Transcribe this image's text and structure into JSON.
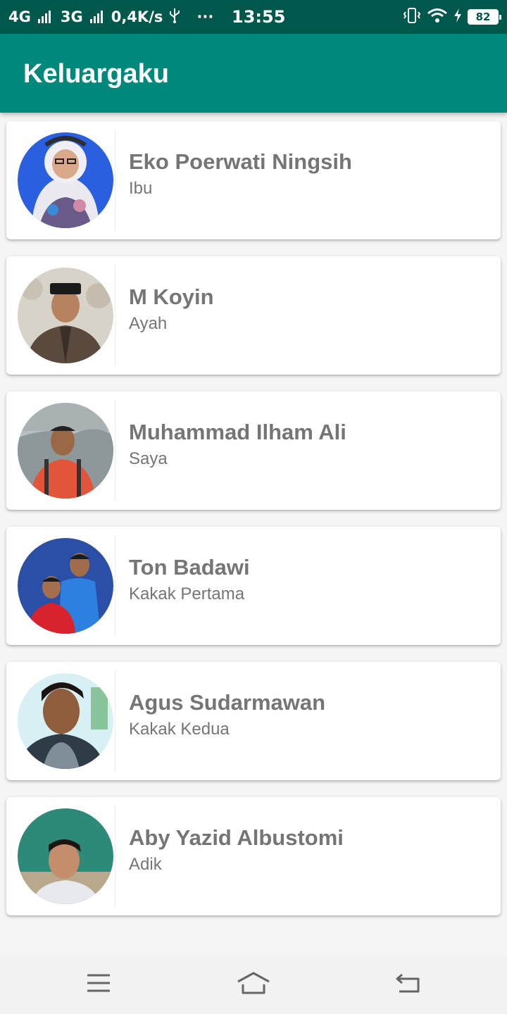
{
  "status_bar": {
    "network_1": "4G",
    "network_2": "3G",
    "speed": "0,4K/s",
    "dots": "···",
    "time": "13:55",
    "battery": "82",
    "icons": [
      "usb-icon",
      "vibrate-icon",
      "wifi-icon",
      "charging-icon",
      "battery-icon"
    ]
  },
  "app_bar": {
    "title": "Keluargaku",
    "color": "#00897b"
  },
  "family": [
    {
      "name": "Eko Poerwati Ningsih",
      "role": "Ibu"
    },
    {
      "name": "M Koyin",
      "role": "Ayah"
    },
    {
      "name": "Muhammad Ilham Ali",
      "role": "Saya"
    },
    {
      "name": "Ton Badawi",
      "role": "Kakak Pertama"
    },
    {
      "name": "Agus Sudarmawan",
      "role": "Kakak Kedua"
    },
    {
      "name": "Aby Yazid Albustomi",
      "role": "Adik"
    }
  ],
  "nav_bar": {
    "icons": [
      "menu-icon",
      "home-icon",
      "back-icon"
    ]
  }
}
